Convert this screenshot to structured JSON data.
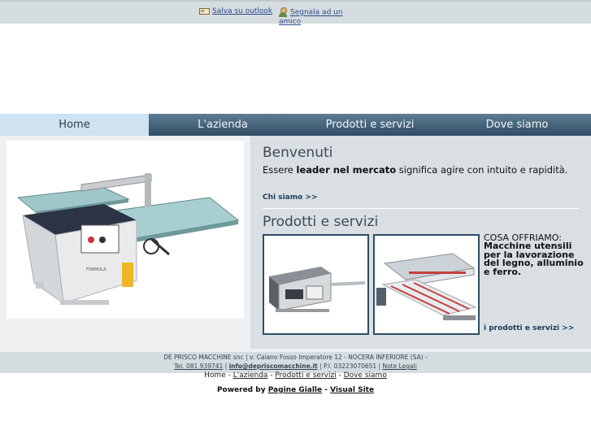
{
  "topbar": {
    "save_outlook": "Salva su outlook",
    "recommend_line1": "Segnala ad un",
    "recommend_line2": "amico"
  },
  "nav": {
    "items": [
      {
        "label": "Home",
        "active": true
      },
      {
        "label": "L'azienda",
        "active": false
      },
      {
        "label": "Prodotti e servizi",
        "active": false
      },
      {
        "label": "Dove siamo",
        "active": false
      }
    ]
  },
  "welcome": {
    "title": "Benvenuti",
    "text_pre": "Essere ",
    "text_bold": "leader nel mercato",
    "text_post": " significa agire con intuito e rapidità.",
    "link": "Chi siamo >>"
  },
  "products": {
    "title": "Prodotti e servizi",
    "offer_label": "COSA OFFRIAMO:",
    "offer_text": "Macchine utensili per la lavorazione del legno, alluminio e ferro.",
    "link": "i prodotti e servizi >>"
  },
  "footer": {
    "line1": "DE PRISCO MACCHINE snc | v. Caiano Fosso Imperatore 12 - NOCERA INFERIORE (SA) -",
    "tel": "Tel. 081 939741",
    "sep1": " | ",
    "email": "info@depriscomacchine.it",
    "piva": " | P.I. 03223070651 | ",
    "legal": "Note Legali"
  },
  "footnav": {
    "home": "Home",
    "sep": " - ",
    "azienda": "L'azienda",
    "prodotti": "Prodotti e servizi",
    "dove": "Dove siamo"
  },
  "powered": {
    "label": "Powered by ",
    "pagine": "Pagine Gialle",
    "dash": " - ",
    "visual": "Visual Site"
  },
  "colors": {
    "nav_dark": "#2f4d63",
    "nav_active": "#cfe3f2",
    "panel_bg": "#d9dfe2",
    "link": "#1e3a5f"
  }
}
